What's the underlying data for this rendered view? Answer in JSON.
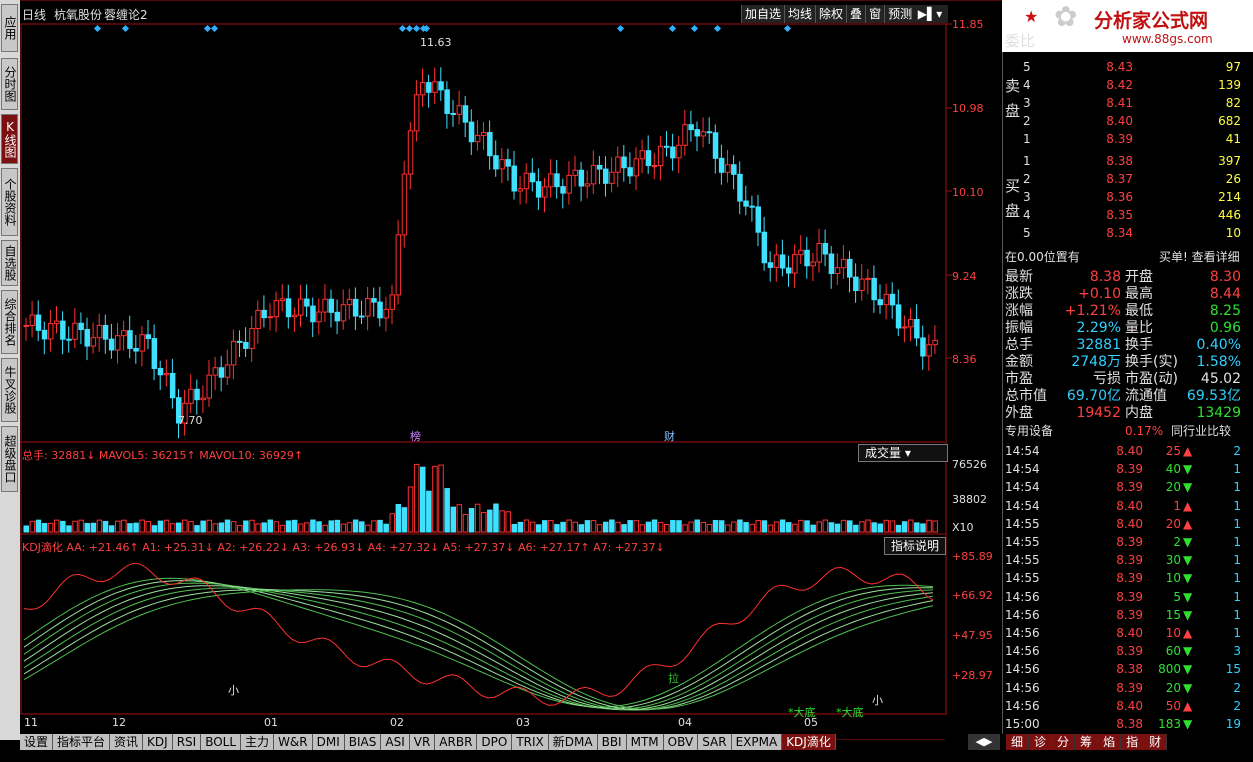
{
  "lefttabs": [
    "应用",
    "分时图",
    "K线图",
    "个股资料",
    "自选股",
    "综合排名",
    "牛叉诊股",
    "超级盘口"
  ],
  "header": {
    "period": "日线",
    "stock": "杭氧股份",
    "indicator": "蓉缠论2"
  },
  "toolbar": [
    "加自选",
    "均线",
    "除权",
    "叠",
    "窗",
    "预测"
  ],
  "price_axis": [
    "11.85",
    "10.98",
    "10.10",
    "9.24",
    "8.36"
  ],
  "hi_label": "11.63",
  "lo_label": "7.70",
  "marks": [
    "榜",
    "财"
  ],
  "vol": {
    "line": "总手: 32881↓ MAVOL5: 36215↑ MAVOL10: 36929↑",
    "select": "成交量",
    "axis": [
      "76526",
      "38802",
      "X10"
    ]
  },
  "kdj": {
    "line": "KDJ滴化  AA: +21.46↑ A1: +25.31↓ A2: +26.22↓ A3: +26.93↓ A4: +27.32↓ A5: +27.37↓ A6: +27.17↑ A7: +27.37↓",
    "btn": "指标说明",
    "axis": [
      "+85.89",
      "+66.92",
      "+47.95",
      "+28.97"
    ],
    "annots": [
      "小",
      "拉",
      "*大底",
      "*大底",
      "小"
    ]
  },
  "months": [
    "11",
    "12",
    "01",
    "02",
    "03",
    "04",
    "05"
  ],
  "bottomtabs": [
    "设置",
    "指标平台",
    "资讯",
    "KDJ",
    "RSI",
    "BOLL",
    "主力",
    "W&R",
    "DMI",
    "BIAS",
    "ASI",
    "VR",
    "ARBR",
    "DPO",
    "TRIX",
    "新DMA",
    "BBI",
    "MTM",
    "OBV",
    "SAR",
    "EXPMA",
    "KDJ滴化"
  ],
  "rightbottomtabs": [
    "细",
    "诊",
    "分",
    "筹",
    "焰",
    "指",
    "财"
  ],
  "logo": {
    "text": "分析家公式网",
    "url": "www.88gs.com"
  },
  "panel": {
    "weibi": "委比",
    "sell_label": "卖盘",
    "buy_label": "买盘",
    "sell": [
      [
        "5",
        "8.43",
        "97"
      ],
      [
        "4",
        "8.42",
        "139"
      ],
      [
        "3",
        "8.41",
        "82"
      ],
      [
        "2",
        "8.40",
        "682"
      ],
      [
        "1",
        "8.39",
        "41"
      ]
    ],
    "buy": [
      [
        "1",
        "8.38",
        "397"
      ],
      [
        "2",
        "8.37",
        "26"
      ],
      [
        "3",
        "8.36",
        "214"
      ],
      [
        "4",
        "8.35",
        "446"
      ],
      [
        "5",
        "8.34",
        "10"
      ]
    ],
    "pos": "在0.00位置有",
    "buysell": "买单! 查看详细",
    "stats": [
      [
        "最新",
        "8.38",
        "开盘",
        "8.30"
      ],
      [
        "涨跌",
        "+0.10",
        "最高",
        "8.44"
      ],
      [
        "涨幅",
        "+1.21%",
        "最低",
        "8.25"
      ],
      [
        "振幅",
        "2.29%",
        "量比",
        "0.96"
      ],
      [
        "总手",
        "32881",
        "换手",
        "0.40%"
      ],
      [
        "金额",
        "2748万",
        "换手(实)",
        "1.58%"
      ],
      [
        "市盈",
        "亏损",
        "市盈(动)",
        "45.02"
      ],
      [
        "总市值",
        "69.70亿",
        "流通值",
        "69.53亿"
      ],
      [
        "外盘",
        "19452",
        "内盘",
        "13429"
      ]
    ],
    "special": "专用设备",
    "special_pct": "0.17%",
    "compare": "同行业比较",
    "ticks": [
      [
        "14:54",
        "8.40",
        "25",
        "2"
      ],
      [
        "14:54",
        "8.39",
        "40",
        "1"
      ],
      [
        "14:54",
        "8.39",
        "20",
        "1"
      ],
      [
        "14:54",
        "8.40",
        "1",
        "1"
      ],
      [
        "14:55",
        "8.40",
        "20",
        "1"
      ],
      [
        "14:55",
        "8.39",
        "2",
        "1"
      ],
      [
        "14:55",
        "8.39",
        "30",
        "1"
      ],
      [
        "14:55",
        "8.39",
        "10",
        "1"
      ],
      [
        "14:56",
        "8.39",
        "5",
        "1"
      ],
      [
        "14:56",
        "8.39",
        "15",
        "1"
      ],
      [
        "14:56",
        "8.40",
        "10",
        "1"
      ],
      [
        "14:56",
        "8.39",
        "60",
        "3"
      ],
      [
        "14:56",
        "8.38",
        "800",
        "15"
      ],
      [
        "14:56",
        "8.39",
        "20",
        "2"
      ],
      [
        "14:56",
        "8.40",
        "50",
        "2"
      ],
      [
        "15:00",
        "8.38",
        "183",
        "19"
      ]
    ]
  }
}
